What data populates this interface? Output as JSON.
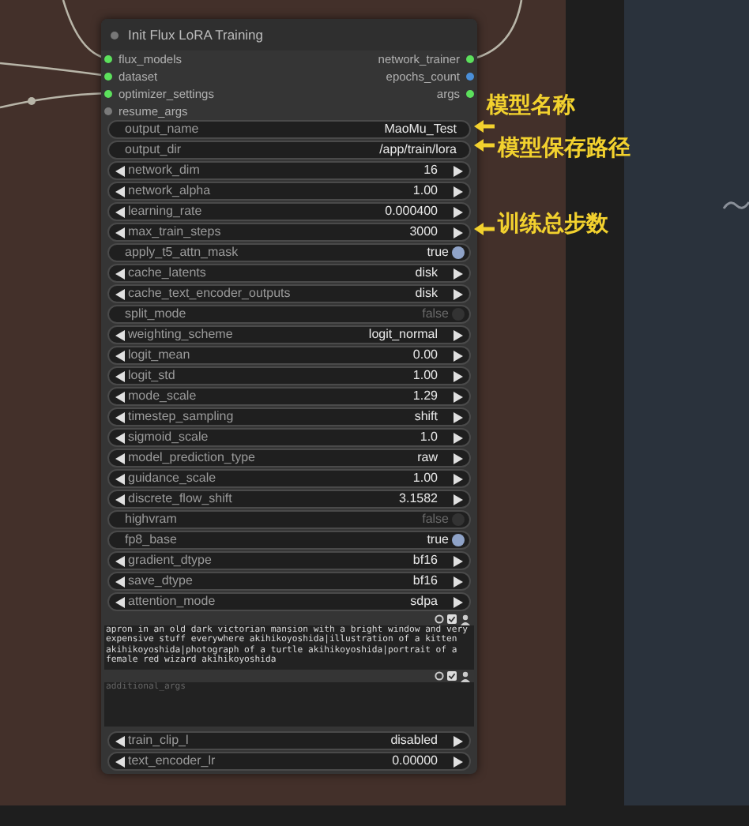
{
  "node": {
    "title": "Init Flux LoRA Training",
    "inputs": [
      {
        "label": "flux_models",
        "color": "#5ce05c"
      },
      {
        "label": "dataset",
        "color": "#5ce05c"
      },
      {
        "label": "optimizer_settings",
        "color": "#5ce05c"
      },
      {
        "label": "resume_args",
        "color": "#7a7a7a"
      }
    ],
    "outputs": [
      {
        "label": "network_trainer",
        "color": "#5ce05c"
      },
      {
        "label": "epochs_count",
        "color": "#4a8fd8"
      },
      {
        "label": "args",
        "color": "#5ce05c"
      }
    ],
    "widgets": [
      {
        "kind": "text",
        "label": "output_name",
        "value": "MaoMu_Test"
      },
      {
        "kind": "text",
        "label": "output_dir",
        "value": "/app/train/lora"
      },
      {
        "kind": "number",
        "label": "network_dim",
        "value": "16"
      },
      {
        "kind": "number",
        "label": "network_alpha",
        "value": "1.00"
      },
      {
        "kind": "number",
        "label": "learning_rate",
        "value": "0.000400"
      },
      {
        "kind": "number",
        "label": "max_train_steps",
        "value": "3000"
      },
      {
        "kind": "toggle",
        "label": "apply_t5_attn_mask",
        "value": "true",
        "on": true
      },
      {
        "kind": "number",
        "label": "cache_latents",
        "value": "disk"
      },
      {
        "kind": "number",
        "label": "cache_text_encoder_outputs",
        "value": "disk"
      },
      {
        "kind": "toggle",
        "label": "split_mode",
        "value": "false",
        "on": false
      },
      {
        "kind": "number",
        "label": "weighting_scheme",
        "value": "logit_normal"
      },
      {
        "kind": "number",
        "label": "logit_mean",
        "value": "0.00"
      },
      {
        "kind": "number",
        "label": "logit_std",
        "value": "1.00"
      },
      {
        "kind": "number",
        "label": "mode_scale",
        "value": "1.29"
      },
      {
        "kind": "number",
        "label": "timestep_sampling",
        "value": "shift"
      },
      {
        "kind": "number",
        "label": "sigmoid_scale",
        "value": "1.0"
      },
      {
        "kind": "number",
        "label": "model_prediction_type",
        "value": "raw"
      },
      {
        "kind": "number",
        "label": "guidance_scale",
        "value": "1.00"
      },
      {
        "kind": "number",
        "label": "discrete_flow_shift",
        "value": "3.1582"
      },
      {
        "kind": "toggle",
        "label": "highvram",
        "value": "false",
        "on": false
      },
      {
        "kind": "toggle",
        "label": "fp8_base",
        "value": "true",
        "on": true
      },
      {
        "kind": "number",
        "label": "gradient_dtype",
        "value": "bf16"
      },
      {
        "kind": "number",
        "label": "save_dtype",
        "value": "bf16"
      },
      {
        "kind": "number",
        "label": "attention_mode",
        "value": "sdpa"
      }
    ],
    "prompt_box": {
      "value": "apron in an old dark victorian mansion with a bright window and very expensive stuff everywhere akihikoyoshida|illustration of a kitten akihikoyoshida|photograph of a turtle akihikoyoshida|portrait of a female red wizard akihikoyoshida"
    },
    "args_box": {
      "placeholder": "additional_args"
    },
    "widgets_after": [
      {
        "kind": "number",
        "label": "train_clip_l",
        "value": "disabled"
      },
      {
        "kind": "number",
        "label": "text_encoder_lr",
        "value": "0.00000"
      }
    ]
  },
  "annotations": [
    {
      "label": "模型名称"
    },
    {
      "label": "模型保存路径"
    },
    {
      "label": "训练总步数"
    }
  ]
}
